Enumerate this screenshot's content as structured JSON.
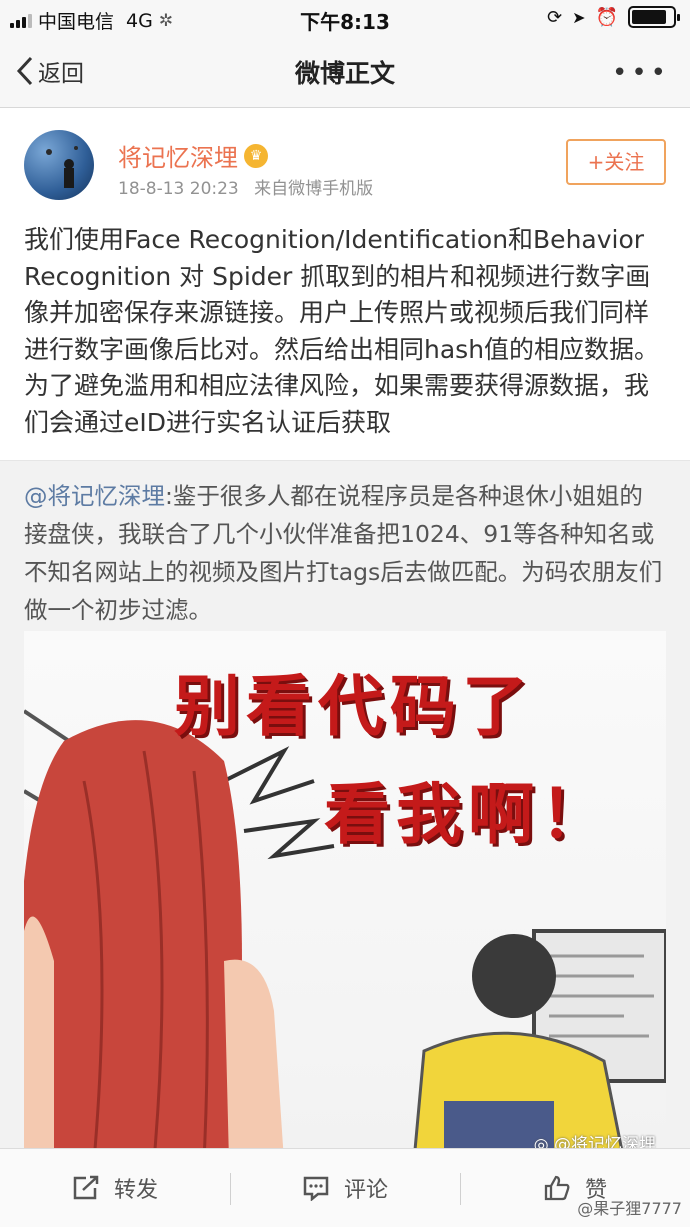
{
  "status_bar": {
    "carrier": "中国电信",
    "network": "4G",
    "time": "下午8:13",
    "battery_level": 0.85
  },
  "nav": {
    "back_label": "返回",
    "title": "微博正文",
    "more_label": "•••"
  },
  "post": {
    "author": "将记忆深埋",
    "time": "18-8-13 20:23",
    "source": "来自微博手机版",
    "follow_label": "+关注",
    "text": "我们使用Face Recognition/Identification和Behavior Recognition 对 Spider 抓取到的相片和视频进行数字画像并加密保存来源链接。用户上传照片或视频后我们同样进行数字画像后比对。然后给出相同hash值的相应数据。为了避免滥用和相应法律风险，如果需要获得源数据，我们会通过eID进行实名认证后获取"
  },
  "retweet": {
    "mention": "@将记忆深埋",
    "text": ":鉴于很多人都在说程序员是各种退休小姐姐的接盘侠，我联合了几个小伙伴准备把1024、91等各种知名或不知名网站上的视频及图片打tags后去做匹配。为码农朋友们做一个初步过滤。",
    "image_line1": "别看代码了",
    "image_line2": "看我啊！",
    "image_watermark": "@将记忆深埋"
  },
  "toolbar": {
    "repost_label": "转发",
    "comment_label": "评论",
    "like_label": "赞"
  },
  "corner_watermark": "@果子狸7777",
  "colors": {
    "accent": "#eb7350",
    "mention": "#5d7ba3",
    "image_text": "#c41a1a"
  }
}
